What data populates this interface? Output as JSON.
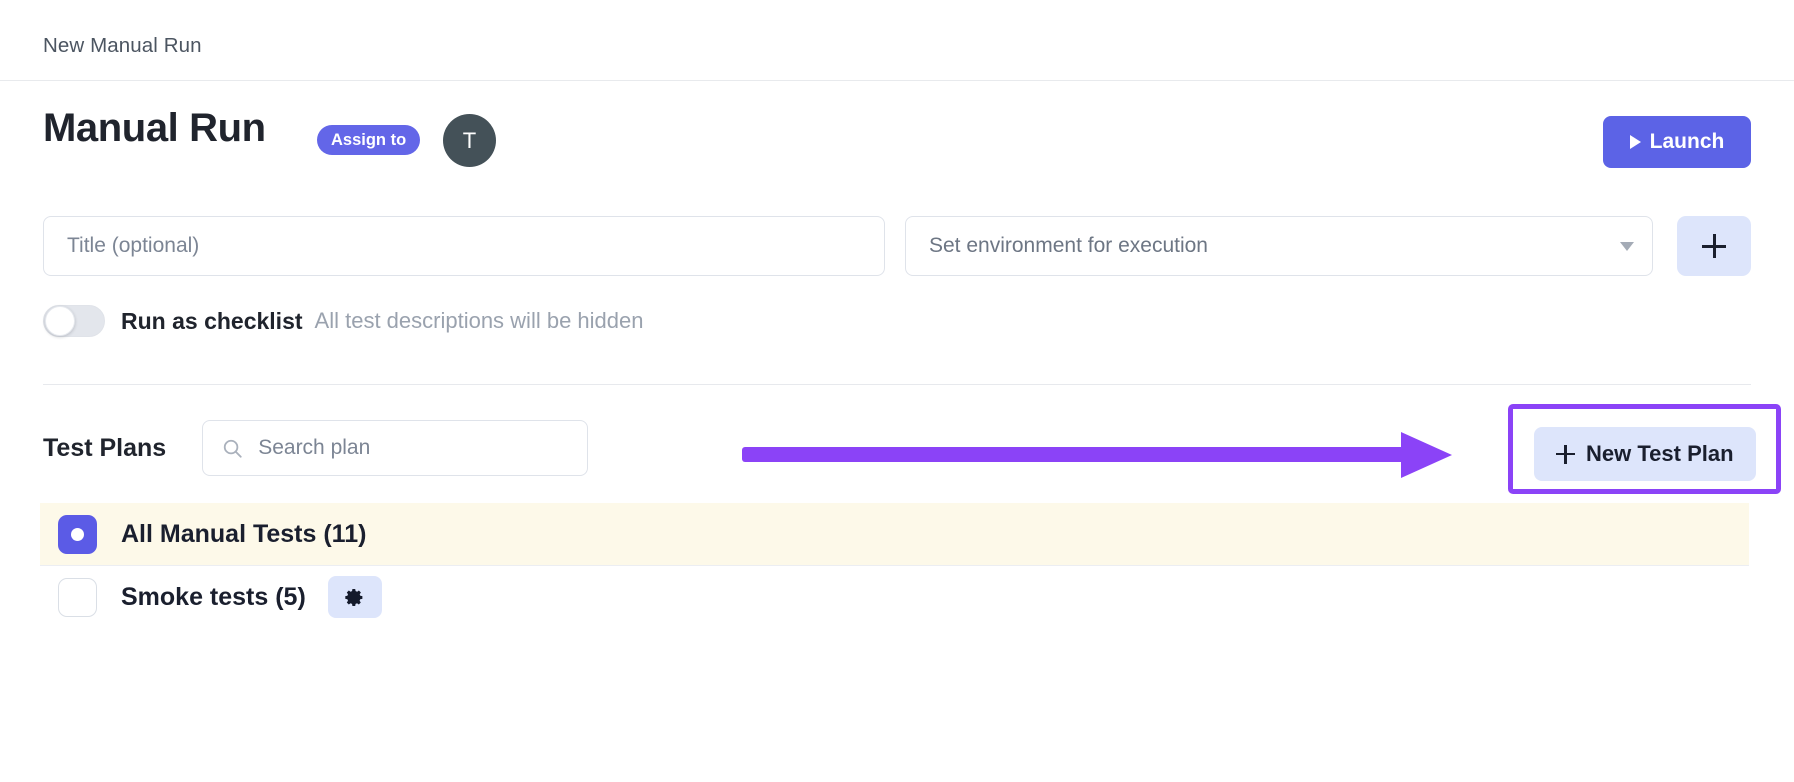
{
  "topbar": {
    "breadcrumb": "New Manual Run"
  },
  "header": {
    "title": "Manual Run",
    "assign_label": "Assign to",
    "avatar_initial": "T",
    "launch_label": "Launch",
    "play_icon": "play-icon"
  },
  "form": {
    "title_placeholder": "Title (optional)",
    "title_value": "",
    "environment_label": "Set environment for execution",
    "environment_caret": "chevron-down-icon",
    "add_environment_icon": "plus-icon"
  },
  "checklist": {
    "toggle_state": "off",
    "label": "Run as checklist",
    "hint": "All test descriptions will be hidden"
  },
  "plans": {
    "section_title": "Test Plans",
    "search_placeholder": "Search plan",
    "search_value": "",
    "search_icon": "search-icon",
    "new_plan_label": "New Test Plan",
    "new_plan_icon": "plus-icon",
    "rows": [
      {
        "name": "All Manual Tests (11)",
        "checked": true,
        "has_gear": false,
        "gear_icon": ""
      },
      {
        "name": "Smoke tests (5)",
        "checked": false,
        "has_gear": true,
        "gear_icon": "gear-icon"
      }
    ]
  },
  "annotations": {
    "arrow_color": "#8b43f7",
    "highlight_color": "#8b43f7",
    "arrow_name": "pointer-arrow",
    "highlight_name": "highlight-box"
  },
  "colors": {
    "accent": "#5c63e6",
    "badge": "#6366e8",
    "selected_row_bg": "#fdf9e9",
    "soft_button_bg": "#dde5fb",
    "avatar_bg": "#445158"
  }
}
